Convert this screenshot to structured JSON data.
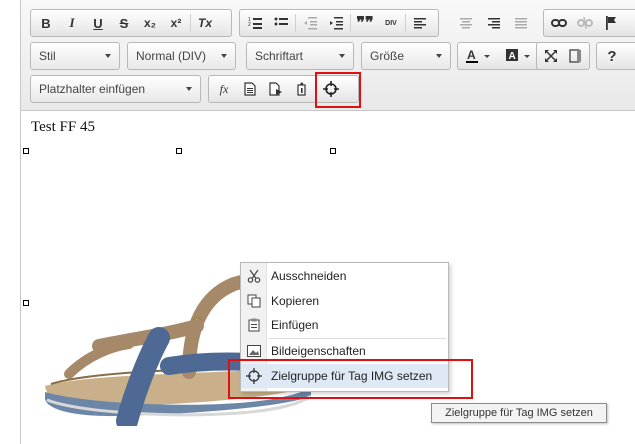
{
  "toolbar": {
    "row1": {
      "bold": "B",
      "italic": "I",
      "underline": "U",
      "strike": "S",
      "subscript": "x₂",
      "superscript": "x²",
      "remove_format": "Tx",
      "blockquote": "❞❞",
      "div": "DIV"
    },
    "row2": {
      "style": "Stil",
      "format": "Normal (DIV)",
      "font": "Schriftart",
      "size": "Größe",
      "help": "?"
    },
    "row3": {
      "placeholder": "Platzhalter einfügen",
      "fx": "fx"
    }
  },
  "editor": {
    "text": "Test FF 45"
  },
  "context_menu": {
    "items": [
      {
        "label": "Ausschneiden",
        "icon": "scissors-icon"
      },
      {
        "label": "Kopieren",
        "icon": "copy-icon"
      },
      {
        "label": "Einfügen",
        "icon": "paste-icon"
      },
      {
        "label": "Bildeigenschaften",
        "icon": "image-icon"
      },
      {
        "label": "Zielgruppe für Tag IMG setzen",
        "icon": "target-icon"
      }
    ]
  },
  "tooltip": "Zielgruppe für Tag IMG setzen",
  "colors": {
    "highlight_box": "#e01010",
    "menu_hover": "#dfe8f5",
    "sandal_strap_brown": "#a58969",
    "sandal_strap_blue": "#4e6a94"
  }
}
